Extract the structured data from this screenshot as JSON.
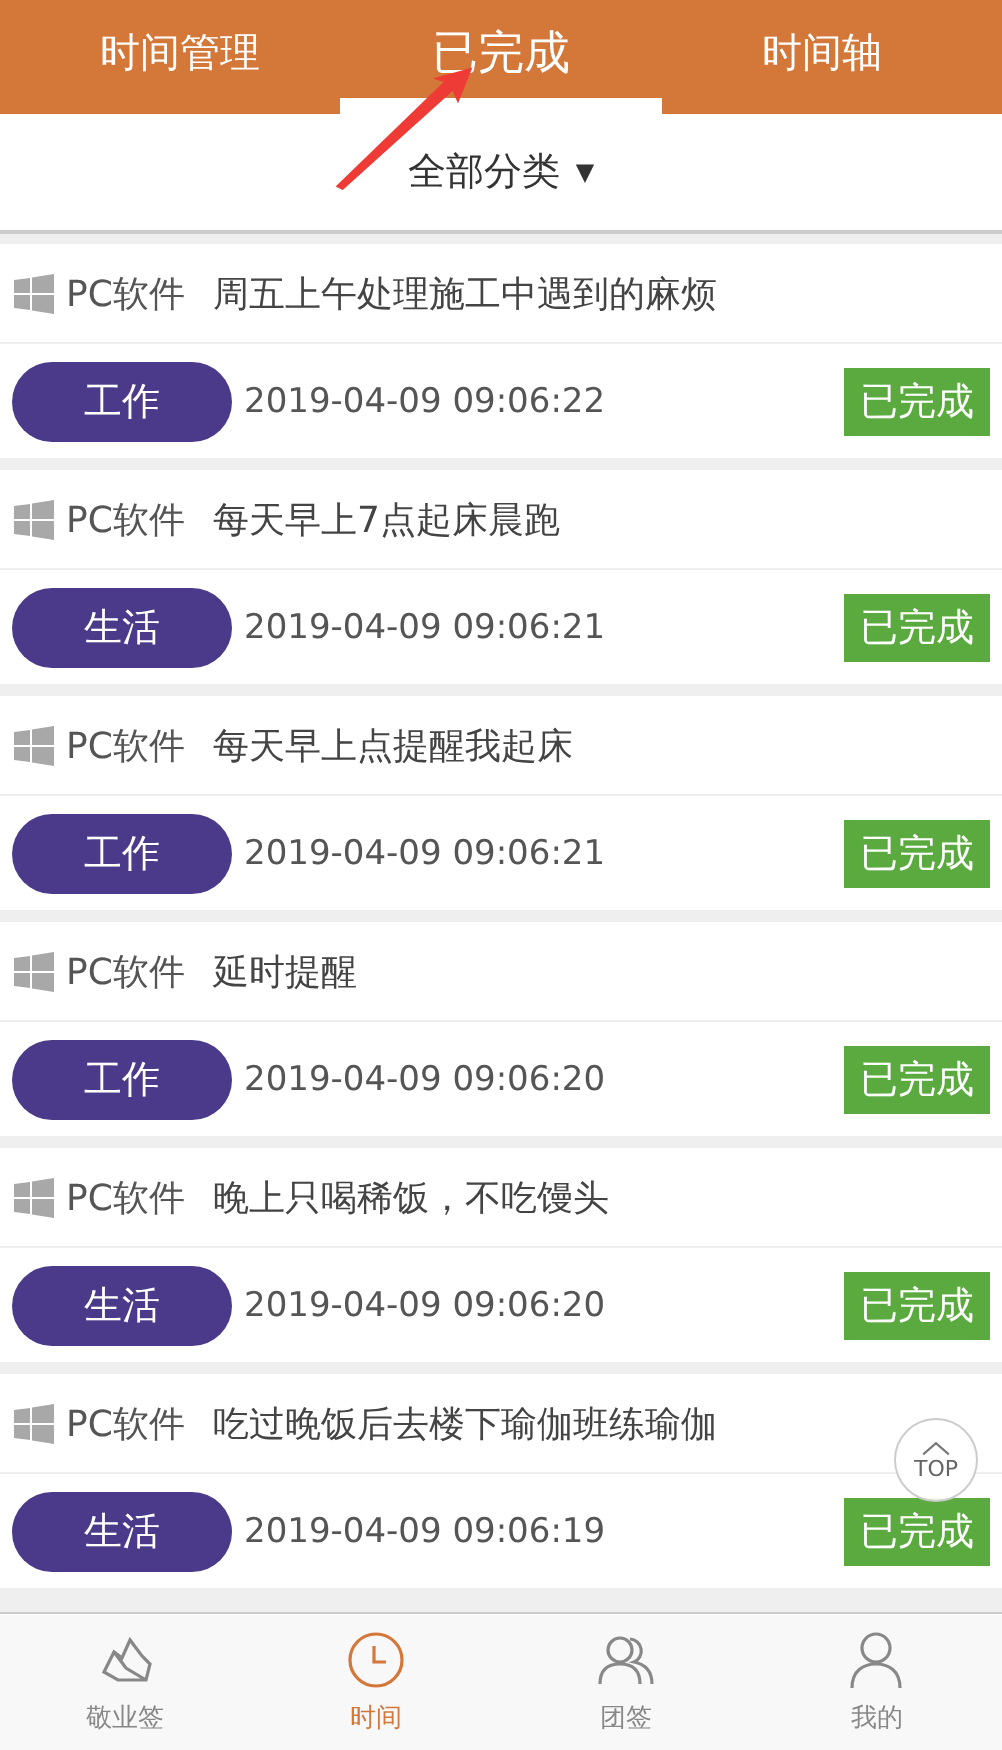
{
  "tabs": [
    {
      "label": "时间管理",
      "selected": false
    },
    {
      "label": "已完成",
      "selected": true
    },
    {
      "label": "时间轴",
      "selected": false
    }
  ],
  "filter": {
    "label": "全部分类",
    "caret": "▼"
  },
  "tasks": [
    {
      "source": "PC软件",
      "title": "周五上午处理施工中遇到的麻烦",
      "tag": "工作",
      "time": "2019-04-09 09:06:22",
      "status": "已完成"
    },
    {
      "source": "PC软件",
      "title": "每天早上7点起床晨跑",
      "tag": "生活",
      "time": "2019-04-09 09:06:21",
      "status": "已完成"
    },
    {
      "source": "PC软件",
      "title": "每天早上点提醒我起床",
      "tag": "工作",
      "time": "2019-04-09 09:06:21",
      "status": "已完成"
    },
    {
      "source": "PC软件",
      "title": "延时提醒",
      "tag": "工作",
      "time": "2019-04-09 09:06:20",
      "status": "已完成"
    },
    {
      "source": "PC软件",
      "title": "晚上只喝稀饭，不吃馒头",
      "tag": "生活",
      "time": "2019-04-09 09:06:20",
      "status": "已完成"
    },
    {
      "source": "PC软件",
      "title": "吃过晚饭后去楼下瑜伽班练瑜伽",
      "tag": "生活",
      "time": "2019-04-09 09:06:19",
      "status": "已完成"
    }
  ],
  "top_button": {
    "label": "TOP"
  },
  "bottom_nav": [
    {
      "kind": "notes",
      "label": "敬业签",
      "selected": false
    },
    {
      "kind": "clock",
      "label": "时间",
      "selected": true
    },
    {
      "kind": "team",
      "label": "团签",
      "selected": false
    },
    {
      "kind": "person",
      "label": "我的",
      "selected": false
    }
  ]
}
